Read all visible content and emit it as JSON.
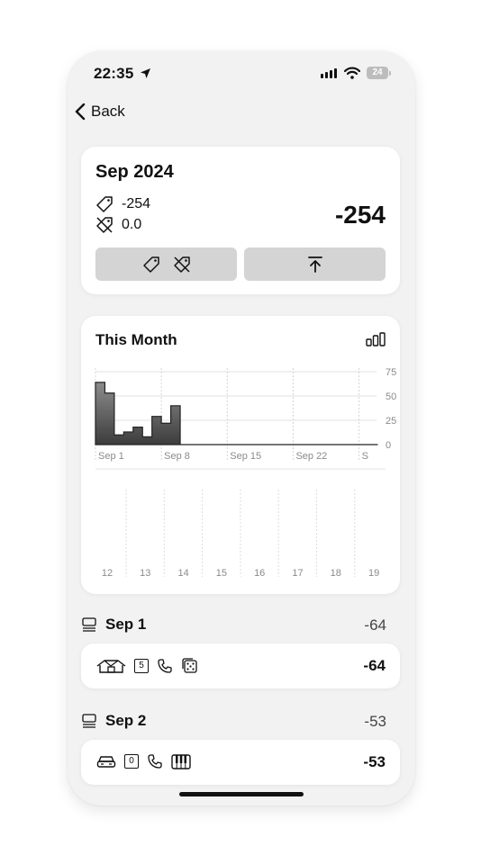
{
  "status": {
    "time": "22:35",
    "battery": "24"
  },
  "nav": {
    "back_label": "Back"
  },
  "summary": {
    "title": "Sep 2024",
    "tagged_value": "-254",
    "untagged_value": "0.0",
    "total": "-254"
  },
  "month": {
    "title": "This Month",
    "daily_labels": [
      "12",
      "13",
      "14",
      "15",
      "16",
      "17",
      "18",
      "19"
    ]
  },
  "chart_data": {
    "type": "area",
    "title": "",
    "xlabel": "",
    "ylabel": "",
    "x_ticks": [
      "Sep 1",
      "Sep 8",
      "Sep 15",
      "Sep 22",
      "S"
    ],
    "y_ticks": [
      0,
      25,
      50,
      75
    ],
    "ylim": [
      0,
      75
    ],
    "x": [
      1,
      2,
      3,
      4,
      5,
      6,
      7,
      8,
      9,
      10,
      11,
      12,
      13,
      14,
      15,
      16,
      17,
      18,
      19,
      20,
      21,
      22,
      23,
      24,
      25,
      26,
      27,
      28,
      29,
      30
    ],
    "values": [
      64,
      53,
      10,
      13,
      18,
      8,
      29,
      22,
      40,
      0,
      0,
      0,
      0,
      0,
      0,
      0,
      0,
      0,
      0,
      0,
      0,
      0,
      0,
      0,
      0,
      0,
      0,
      0,
      0,
      0
    ],
    "grid": true,
    "y_axis_side": "right"
  },
  "days": [
    {
      "label": "Sep 1",
      "total": "-64",
      "amount": "-64",
      "badge": "5",
      "icons": [
        "house-icon",
        "number-badge-icon",
        "phone-icon",
        "dice-icon"
      ]
    },
    {
      "label": "Sep 2",
      "total": "-53",
      "amount": "-53",
      "badge": "0",
      "icons": [
        "car-icon",
        "number-badge-icon",
        "phone-icon",
        "piano-icon"
      ]
    }
  ]
}
